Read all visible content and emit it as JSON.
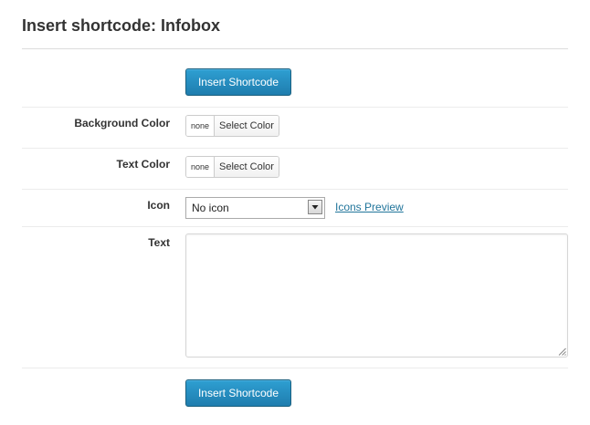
{
  "dialog": {
    "title": "Insert shortcode: Infobox"
  },
  "toolbar": {
    "insert_label_top": "Insert Shortcode",
    "insert_label_bottom": "Insert Shortcode"
  },
  "fields": {
    "background_color": {
      "label": "Background Color",
      "value": "none",
      "button_label": "Select Color"
    },
    "text_color": {
      "label": "Text Color",
      "value": "none",
      "button_label": "Select Color"
    },
    "icon": {
      "label": "Icon",
      "selected": "No icon",
      "preview_link": "Icons Preview",
      "arrow_icon": "chevron-down-icon"
    },
    "text": {
      "label": "Text",
      "value": "",
      "resize_icon": "resize-grip-icon"
    }
  },
  "colors": {
    "primary_button": "#2589bf",
    "link": "#21759b",
    "label_text": "#333333"
  }
}
